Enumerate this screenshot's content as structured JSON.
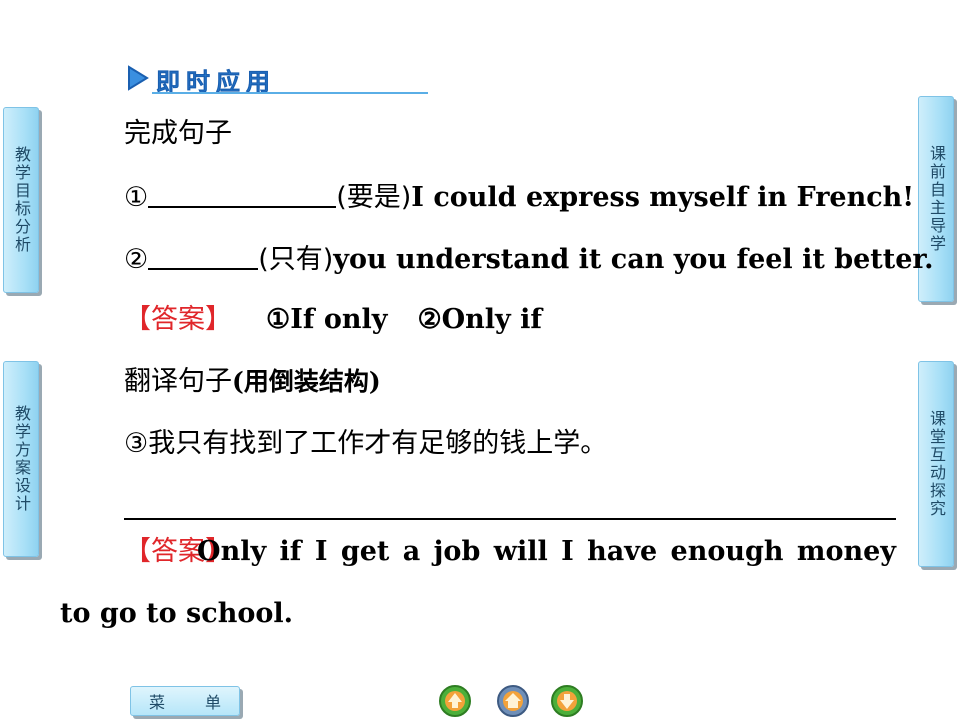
{
  "header": {
    "title": "即时应用"
  },
  "left_tabs": [
    {
      "label": "教学目标分析"
    },
    {
      "label": "教学方案设计"
    }
  ],
  "right_tabs": [
    {
      "label": "课前自主导学"
    },
    {
      "label": "课堂互动探究"
    }
  ],
  "content": {
    "section1_title": "完成句子",
    "q1": {
      "num": "①",
      "hint": "(要是)",
      "text": "I could express myself in French!"
    },
    "q2": {
      "num": "②",
      "hint": "(只有)",
      "text": "you understand it can you feel it better."
    },
    "answer1": {
      "label": "【答案】",
      "a1": "①If only",
      "a2": "②Only if"
    },
    "section2_title_cn": "翻译句子",
    "section2_title_paren": "(用倒装结构)",
    "q3": "③我只有找到了工作才有足够的钱上学。",
    "answer2": {
      "label": "【答案】",
      "text_line1": "Only if I get a job will I have enough money",
      "text_line2": "to go to school."
    }
  },
  "bottom": {
    "menu_left": "菜",
    "menu_right": "单",
    "icons": [
      "prev-icon",
      "home-icon",
      "next-icon"
    ]
  },
  "colors": {
    "accent": "#2a7fd4",
    "answer_red": "#e0262a",
    "tab_bg": "#a9e0f7"
  }
}
